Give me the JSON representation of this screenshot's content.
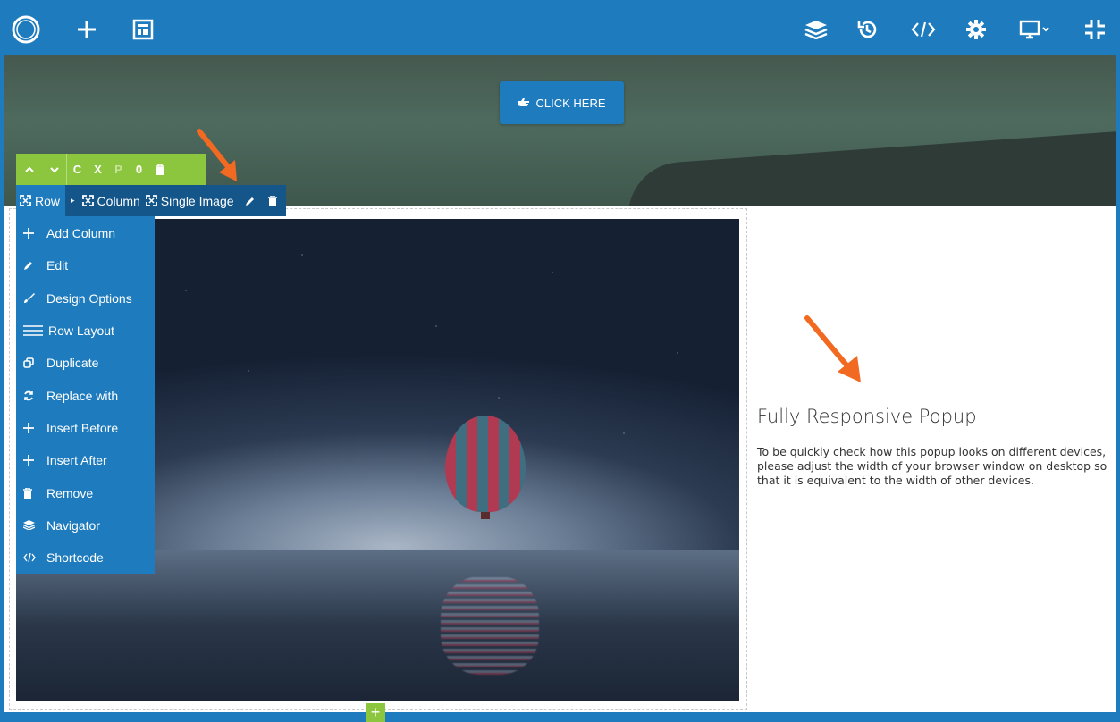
{
  "toolbar": {
    "left_icons": [
      "logo-icon",
      "add-element-icon",
      "templates-icon"
    ],
    "right_icons": [
      "layers-icon",
      "history-icon",
      "code-icon",
      "settings-icon",
      "device-icon",
      "collapse-icon"
    ]
  },
  "hero": {
    "button_label": "CLICK HERE",
    "button_icon": "hand-point-icon"
  },
  "controls": {
    "buttons": [
      "C",
      "X",
      "P",
      "0"
    ]
  },
  "breadcrumb": {
    "row": "Row",
    "column": "Column",
    "single_image": "Single Image"
  },
  "menu": {
    "items": [
      {
        "label": "Add Column",
        "icon": "plus-icon"
      },
      {
        "label": "Edit",
        "icon": "pencil-icon"
      },
      {
        "label": "Design Options",
        "icon": "brush-icon"
      },
      {
        "label": "Row Layout",
        "icon": "lines-icon"
      },
      {
        "label": "Duplicate",
        "icon": "duplicate-icon"
      },
      {
        "label": "Replace with",
        "icon": "replace-icon"
      },
      {
        "label": "Insert Before",
        "icon": "plus-icon"
      },
      {
        "label": "Insert After",
        "icon": "plus-icon"
      },
      {
        "label": "Remove",
        "icon": "trash-icon"
      },
      {
        "label": "Navigator",
        "icon": "layers-icon"
      },
      {
        "label": "Shortcode",
        "icon": "code-icon"
      }
    ]
  },
  "popup": {
    "title": "Fully Responsive Popup",
    "text": "To be quickly check how this popup looks on different devices, please adjust the width of your browser window on desktop so that it is equivalent to the width of other devices."
  },
  "colors": {
    "primary": "#1e7bbd",
    "dark_primary": "#14558a",
    "green": "#8cc63f",
    "arrow": "#f26a21"
  }
}
